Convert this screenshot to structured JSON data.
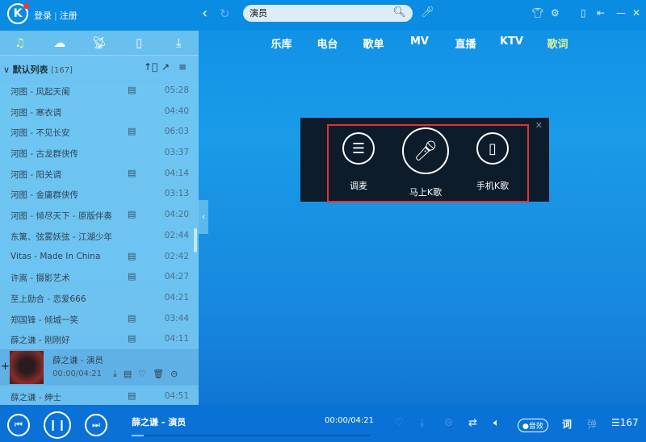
{
  "header": {
    "logo": "K",
    "login": "登录",
    "register": "注册",
    "search_value": "演员",
    "search_placeholder": ""
  },
  "panel_tabs": [
    "music-note-icon",
    "cloud-icon",
    "radio-icon",
    "device-icon",
    "download-icon"
  ],
  "list": {
    "title": "默认列表",
    "count": "[167]"
  },
  "songs": [
    {
      "name": "河图 - 风起天阑",
      "mv": true,
      "dur": "05:28"
    },
    {
      "name": "河图 - 寒衣调",
      "mv": false,
      "dur": "04:40"
    },
    {
      "name": "河图 - 不见长安",
      "mv": true,
      "dur": "06:03"
    },
    {
      "name": "河图 - 古龙群侠传",
      "mv": false,
      "dur": "03:37"
    },
    {
      "name": "河图 - 阳关调",
      "mv": true,
      "dur": "04:14"
    },
    {
      "name": "河图 - 金庸群侠传",
      "mv": false,
      "dur": "03:13"
    },
    {
      "name": "河图 - 倾尽天下 - 原版伴奏",
      "mv": true,
      "dur": "04:20"
    },
    {
      "name": "东篱、弦雾妖弦 - 江湖少年",
      "mv": false,
      "dur": "02:44"
    },
    {
      "name": "Vitas - Made In China",
      "mv": true,
      "dur": "02:42"
    },
    {
      "name": "许嵩 - 摄影艺术",
      "mv": true,
      "dur": "04:27"
    },
    {
      "name": "至上励合 - 恋爱666",
      "mv": false,
      "dur": "04:21"
    },
    {
      "name": "郑国锋 - 倾城一笑",
      "mv": true,
      "dur": "03:44"
    },
    {
      "name": "薛之谦 - 刚刚好",
      "mv": true,
      "dur": "04:11"
    }
  ],
  "playing": {
    "name": "薛之谦 - 演员",
    "time": "00:00/04:21"
  },
  "after": {
    "name": "薛之谦 - 绅士",
    "mv": true,
    "dur": "04:51"
  },
  "nav": [
    "乐库",
    "电台",
    "歌单",
    "MV",
    "直播",
    "KTV",
    "歌词"
  ],
  "karaoke": {
    "tune": "调麦",
    "sing_now": "马上K歌",
    "phone": "手机K歌"
  },
  "player": {
    "title": "薛之谦 - 演员",
    "time": "00:00/04:21",
    "progress": 0.05,
    "effects": "音效",
    "lyrics": "词",
    "danmaku": "弹",
    "playlist_count": "167"
  },
  "colors": {
    "accent": "#0a8ce3",
    "highlight": "#e0323a"
  }
}
